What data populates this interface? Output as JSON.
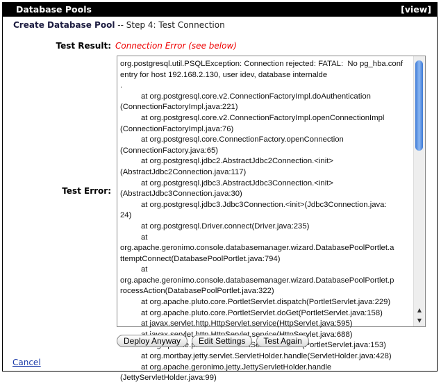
{
  "header": {
    "title": "Database Pools",
    "view_link": "[view]"
  },
  "step": {
    "title": "Create Database Pool",
    "subtitle": " -- Step 4: Test Connection"
  },
  "test_result": {
    "label": "Test Result:",
    "value": "Connection Error (see below)"
  },
  "test_error": {
    "label": "Test Error:",
    "lines": [
      "org.postgresql.util.PSQLException: Connection rejected: FATAL:  No pg_hba.conf entry for host 192.168.2.130, user idev, database internalde",
      ".",
      "\tat org.postgresql.core.v2.ConnectionFactoryImpl.doAuthentication",
      "(ConnectionFactoryImpl.java:221)",
      "\tat org.postgresql.core.v2.ConnectionFactoryImpl.openConnectionImpl",
      "(ConnectionFactoryImpl.java:76)",
      "\tat org.postgresql.core.ConnectionFactory.openConnection",
      "(ConnectionFactory.java:65)",
      "\tat org.postgresql.jdbc2.AbstractJdbc2Connection.<init>",
      "(AbstractJdbc2Connection.java:117)",
      "\tat org.postgresql.jdbc3.AbstractJdbc3Connection.<init>",
      "(AbstractJdbc3Connection.java:30)",
      "\tat org.postgresql.jdbc3.Jdbc3Connection.<init>(Jdbc3Connection.java:",
      "24)",
      "\tat org.postgresql.Driver.connect(Driver.java:235)",
      "\tat",
      "org.apache.geronimo.console.databasemanager.wizard.DatabasePoolPortlet.a",
      "ttemptConnect(DatabasePoolPortlet.java:794)",
      "\tat",
      "org.apache.geronimo.console.databasemanager.wizard.DatabasePoolPortlet.p",
      "rocessAction(DatabasePoolPortlet.java:322)",
      "\tat org.apache.pluto.core.PortletServlet.dispatch(PortletServlet.java:229)",
      "\tat org.apache.pluto.core.PortletServlet.doGet(PortletServlet.java:158)",
      "\tat javax.servlet.http.HttpServlet.service(HttpServlet.java:595)",
      "\tat javax.servlet.http.HttpServlet.service(HttpServlet.java:688)",
      "\tat org.apache.pluto.core.PortletServlet.service(PortletServlet.java:153)",
      "\tat org.mortbay.jetty.servlet.ServletHolder.handle(ServletHolder.java:428)",
      "\tat org.apache.geronimo.jetty.JettyServletHolder.handle",
      "(JettyServletHolder.java:99)"
    ]
  },
  "buttons": {
    "deploy": "Deploy Anyway",
    "edit": "Edit Settings",
    "test": "Test Again"
  },
  "cancel": "Cancel"
}
